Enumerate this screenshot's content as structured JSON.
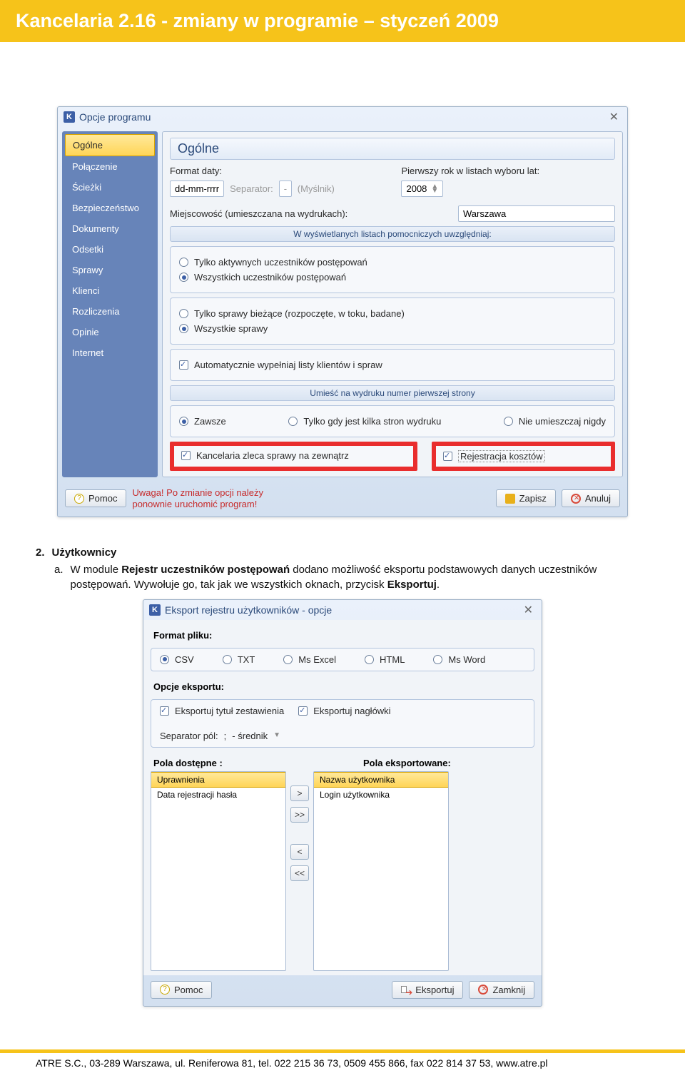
{
  "header": {
    "title": "Kancelaria 2.16 - zmiany w programie – styczeń 2009"
  },
  "dlg1": {
    "title": "Opcje programu",
    "sidebar": [
      "Ogólne",
      "Połączenie",
      "Ścieżki",
      "Bezpieczeństwo",
      "Dokumenty",
      "Odsetki",
      "Sprawy",
      "Klienci",
      "Rozliczenia",
      "Opinie",
      "Internet"
    ],
    "panel_title": "Ogólne",
    "labels": {
      "format_daty": "Format daty:",
      "pierwszy_rok": "Pierwszy rok w listach wyboru lat:",
      "date_format": "dd-mm-rrrr",
      "separator_lbl": "Separator:",
      "separator_val": "-",
      "separator_name": "(Myślnik)",
      "year": "2008",
      "miejscowosc_lbl": "Miejscowość (umieszczana na wydrukach):",
      "miejscowosc_val": "Warszawa",
      "subhead1": "W wyświetlanych listach pomocniczych uwzględniaj:",
      "r1a": "Tylko aktywnych uczestników postępowań",
      "r1b": "Wszystkich uczestników postępowań",
      "r2a": "Tylko sprawy bieżące (rozpoczęte, w toku, badane)",
      "r2b": "Wszystkie sprawy",
      "chk_auto": "Automatycznie wypełniaj listy klientów i spraw",
      "subhead2": "Umieść na wydruku numer pierwszej strony",
      "r3a": "Zawsze",
      "r3b": "Tylko gdy jest kilka stron wydruku",
      "r3c": "Nie umieszczaj nigdy",
      "chk_zleca": "Kancelaria zleca sprawy na zewnątrz",
      "chk_rejestr": "Rejestracja kosztów"
    },
    "warn1": "Uwaga! Po zmianie opcji należy",
    "warn2": "ponownie uruchomić program!",
    "btn_help": "Pomoc",
    "btn_save": "Zapisz",
    "btn_cancel": "Anuluj"
  },
  "body": {
    "section_num": "2.",
    "section_title": "Użytkownicy",
    "item_letter": "a.",
    "item_text_pre": "W module ",
    "item_text_bold": "Rejestr uczestników postępowań",
    "item_text_mid": " dodano możliwość eksportu podstawowych danych uczestników postępowań. Wywołuje go, tak jak we wszystkich oknach, przycisk ",
    "item_text_bold2": "Eksportuj",
    "item_text_end": "."
  },
  "dlg2": {
    "title": "Eksport rejestru użytkowników  - opcje",
    "format_lbl": "Format pliku:",
    "formats": [
      "CSV",
      "TXT",
      "Ms Excel",
      "HTML",
      "Ms Word"
    ],
    "opcje_lbl": "Opcje eksportu:",
    "chk_tytul": "Eksportuj tytuł zestawienia",
    "chk_naglowki": "Eksportuj nagłówki",
    "sep_lbl": "Separator pól:",
    "sep_val": ";",
    "sep_name": "- średnik",
    "pola_dost": "Pola dostępne :",
    "pola_eksp": "Pola eksportowane:",
    "avail": [
      "Uprawnienia",
      "Data rejestracji hasła"
    ],
    "chosen": [
      "Nazwa użytkownika",
      "Login użytkownika"
    ],
    "arr": {
      "r": ">",
      "rr": ">>",
      "l": "<",
      "ll": "<<"
    },
    "btn_help": "Pomoc",
    "btn_export": "Eksportuj",
    "btn_close": "Zamknij"
  },
  "footer": "ATRE S.C., 03-289 Warszawa, ul. Reniferowa 81, tel. 022 215 36 73, 0509 455 866, fax 022 814 37 53, www.atre.pl"
}
